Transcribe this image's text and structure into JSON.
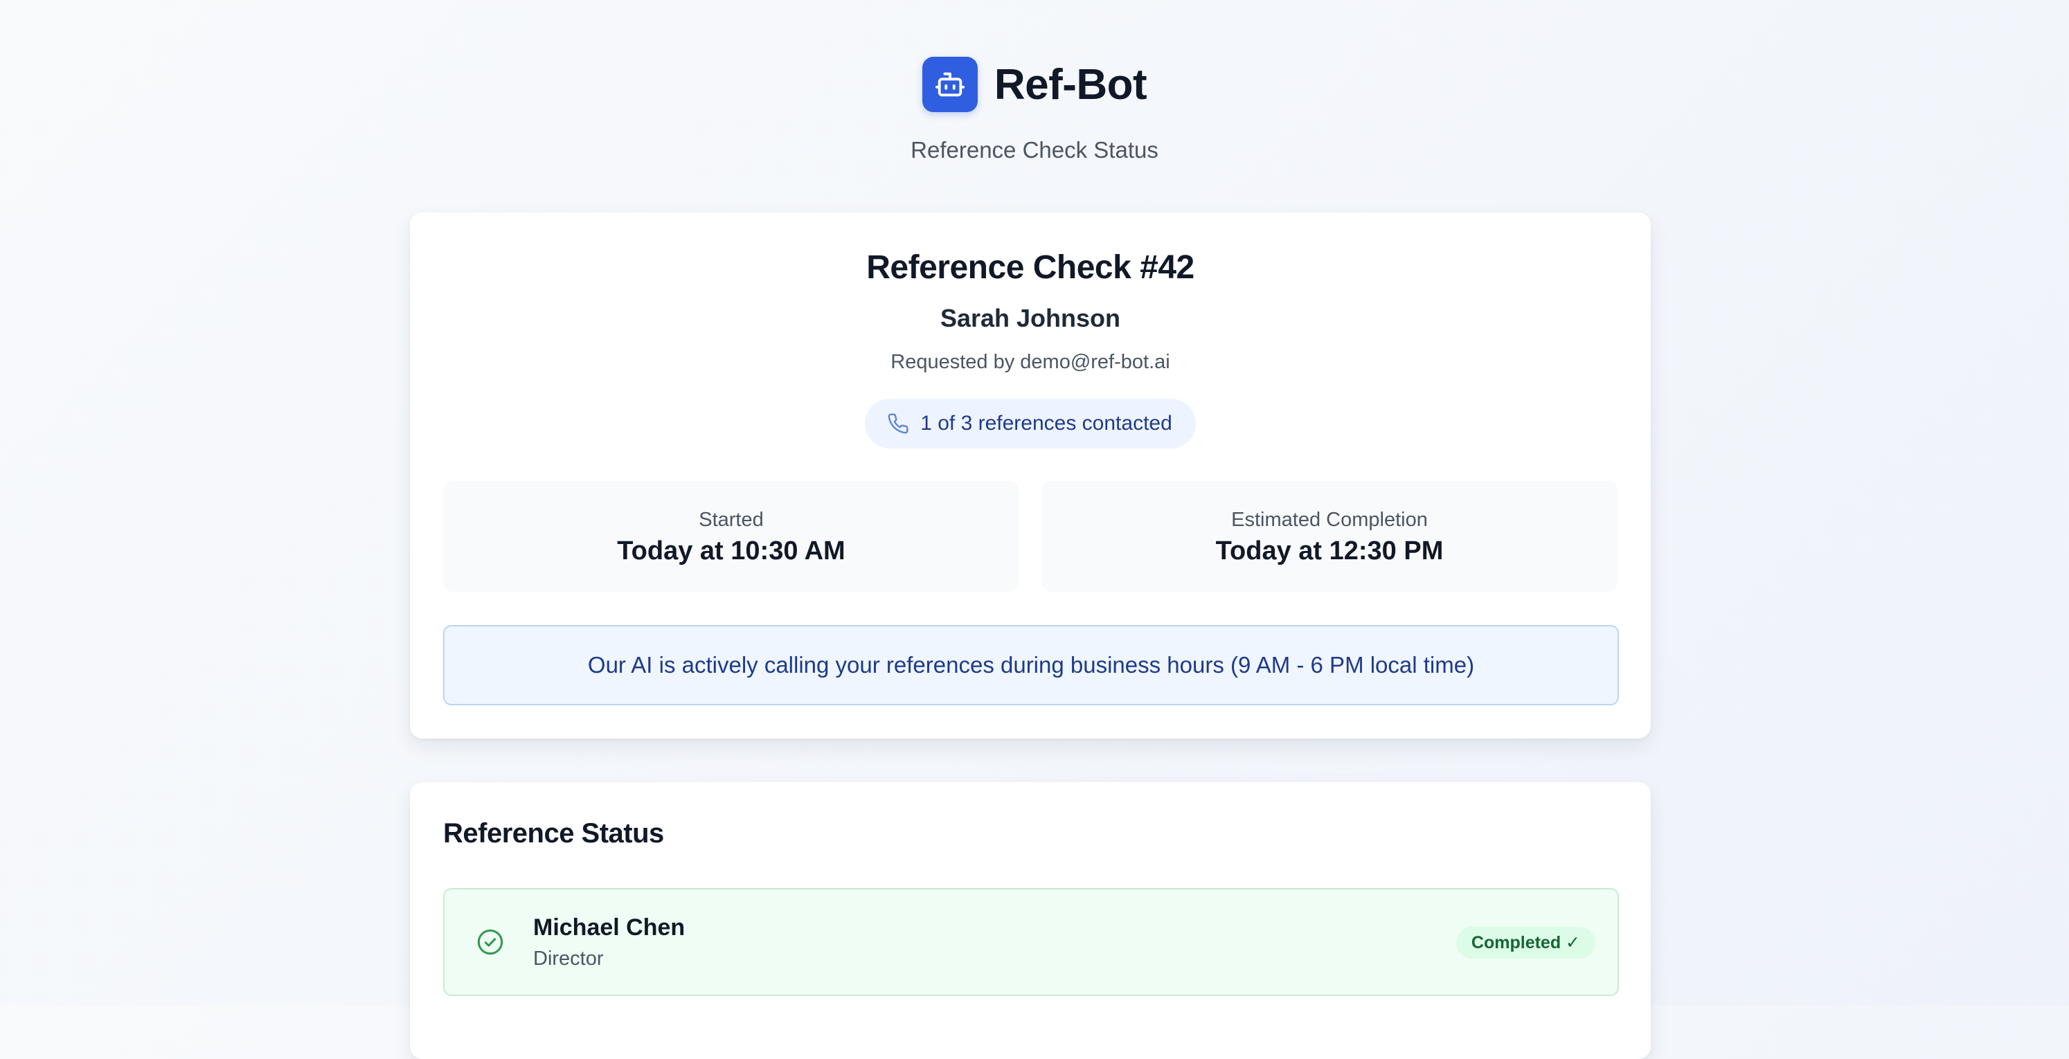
{
  "header": {
    "brand_name": "Ref-Bot",
    "subtitle": "Reference Check Status",
    "logo_icon": "robot-icon",
    "accent_color": "#2f5fe0"
  },
  "check": {
    "title": "Reference Check #42",
    "candidate_name": "Sarah Johnson",
    "requested_by": "Requested by demo@ref-bot.ai",
    "progress_pill": {
      "icon": "phone-icon",
      "text": "1 of 3 references contacted"
    },
    "started": {
      "label": "Started",
      "value": "Today at 10:30 AM"
    },
    "estimated_completion": {
      "label": "Estimated Completion",
      "value": "Today at 12:30 PM"
    },
    "info_banner": "Our AI is actively calling your references during business hours (9 AM - 6 PM local time)"
  },
  "reference_status": {
    "title": "Reference Status",
    "references": [
      {
        "name": "Michael Chen",
        "role": "Director",
        "status": "Completed ✓",
        "icon": "check-circle-icon",
        "status_color": "#166534"
      }
    ]
  }
}
